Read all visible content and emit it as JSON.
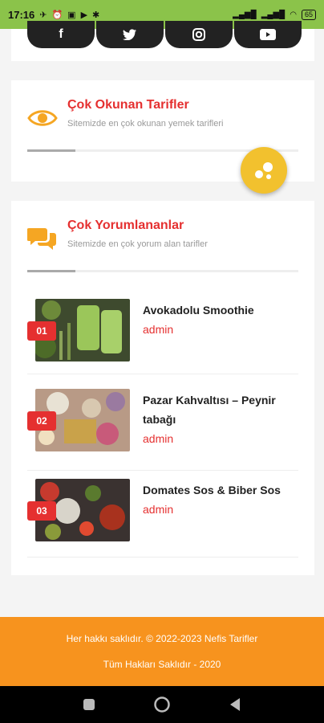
{
  "status_bar": {
    "time": "17:16",
    "battery": "65"
  },
  "social": {
    "icons": [
      "facebook-icon",
      "twitter-icon",
      "instagram-icon",
      "youtube-icon"
    ]
  },
  "most_read": {
    "title": "Çok Okunan Tarifler",
    "subtitle": "Sitemizde en çok okunan yemek tarifleri",
    "icon": "eye-icon"
  },
  "most_commented": {
    "title": "Çok Yorumlananlar",
    "subtitle": "Sitemizde en çok yorum alan tarifler",
    "icon": "chat-bubbles-icon",
    "posts": [
      {
        "rank": "01",
        "title": "Avokadolu Smoothie",
        "author": "admin"
      },
      {
        "rank": "02",
        "title": "Pazar Kahvaltısı – Peynir tabağı",
        "author": "admin"
      },
      {
        "rank": "03",
        "title": "Domates Sos & Biber Sos",
        "author": "admin"
      }
    ]
  },
  "footer": {
    "line1": "Her hakkı saklıdır. © 2022-2023 Nefis Tarifler",
    "line2": "Tüm Hakları Saklıdır - 2020"
  },
  "colors": {
    "accent_red": "#e53030",
    "footer_orange": "#f7931e",
    "fab_yellow": "#f2c12e",
    "icon_orange": "#f5a623"
  }
}
